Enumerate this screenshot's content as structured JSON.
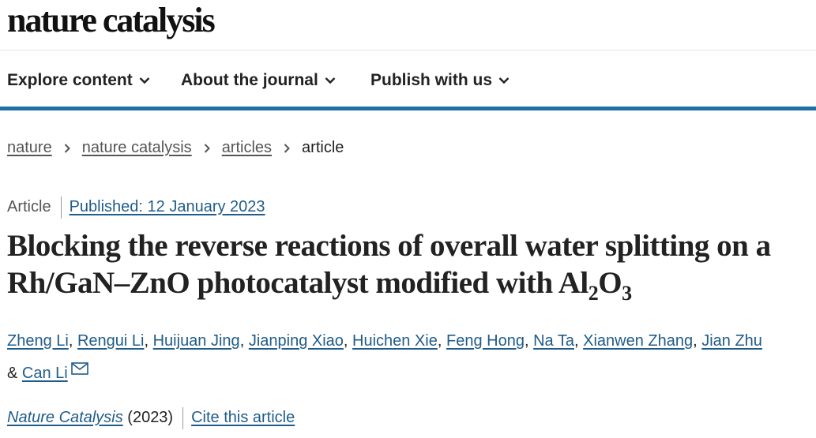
{
  "header": {
    "logo_text": "nature catalysis"
  },
  "nav": {
    "items": [
      {
        "label": "Explore content",
        "icon": "chevron-down-icon"
      },
      {
        "label": "About the journal",
        "icon": "chevron-down-icon"
      },
      {
        "label": "Publish with us",
        "icon": "chevron-down-icon"
      }
    ],
    "accent_color": "#1f6ea3"
  },
  "breadcrumb": {
    "items": [
      "nature",
      "nature catalysis",
      "articles"
    ],
    "current": "article",
    "separator_icon": "chevron-right-icon"
  },
  "article": {
    "type": "Article",
    "published": "Published: 12 January 2023",
    "title_main": "Blocking the reverse reactions of overall water splitting on a Rh/GaN–ZnO photocatalyst modified with Al",
    "title_sub_1": "2",
    "title_o": "O",
    "title_sub_2": "3",
    "authors": [
      "Zheng Li",
      "Rengui Li",
      "Huijuan Jing",
      "Jianping Xiao",
      "Huichen Xie",
      "Feng Hong",
      "Na Ta",
      "Xianwen Zhang",
      "Jian Zhu",
      "Can Li"
    ],
    "author_separator": ",",
    "last_author_conjunction": "&",
    "corresponding_icon": "envelope-icon",
    "journal": "Nature Catalysis",
    "year": "(2023)",
    "cite_label": "Cite this article",
    "link_color": "#1f5c8a"
  }
}
